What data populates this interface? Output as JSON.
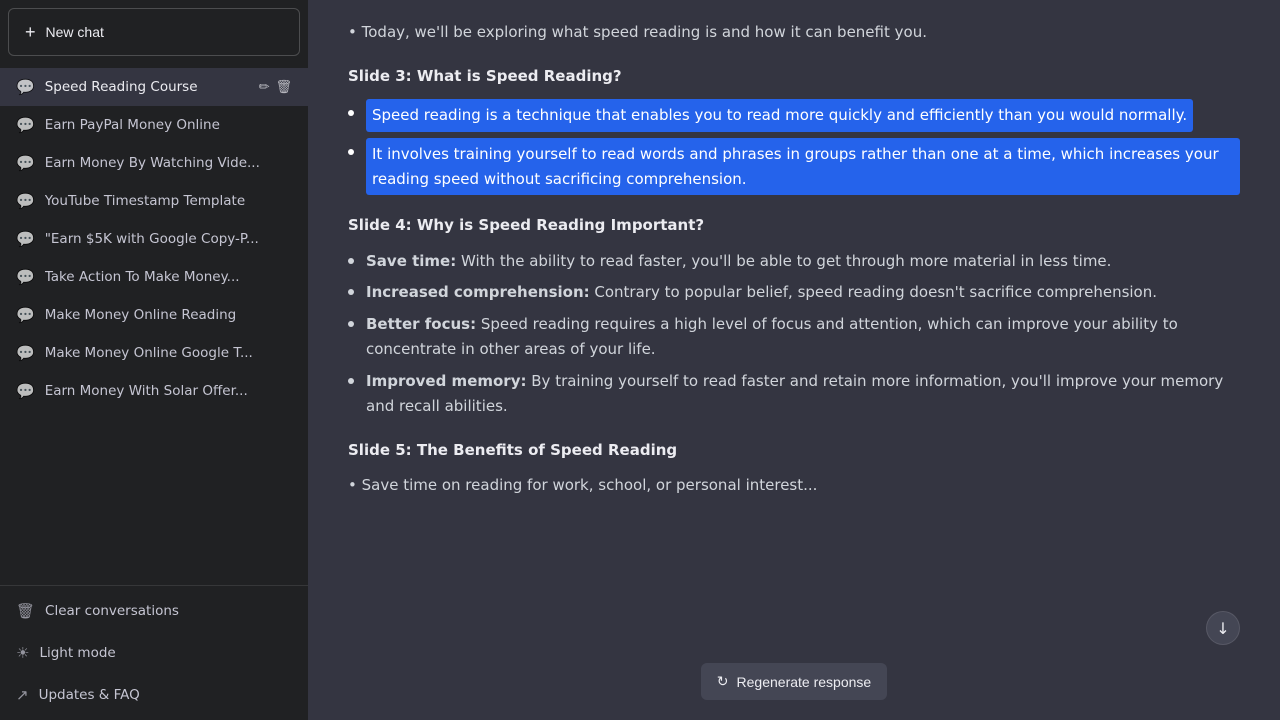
{
  "sidebar": {
    "new_chat_label": "New chat",
    "conversations": [
      {
        "id": "speed-reading",
        "label": "Speed Reading Course",
        "active": true,
        "show_actions": true
      },
      {
        "id": "earn-paypal",
        "label": "Earn PayPal Money Online",
        "active": false,
        "show_actions": false
      },
      {
        "id": "earn-watching",
        "label": "Earn Money By Watching Vide...",
        "active": false,
        "show_actions": false
      },
      {
        "id": "yt-timestamp",
        "label": "YouTube Timestamp Template",
        "active": false,
        "show_actions": false
      },
      {
        "id": "earn-5k-google",
        "label": "\"Earn $5K with Google Copy-P...",
        "active": false,
        "show_actions": false
      },
      {
        "id": "take-action",
        "label": "Take Action To Make Money...",
        "active": false,
        "show_actions": false
      },
      {
        "id": "make-money-reading",
        "label": "Make Money Online Reading",
        "active": false,
        "show_actions": false
      },
      {
        "id": "make-money-google",
        "label": "Make Money Online Google T...",
        "active": false,
        "show_actions": false
      },
      {
        "id": "earn-solar",
        "label": "Earn Money With Solar Offer...",
        "active": false,
        "show_actions": false
      }
    ],
    "bottom_items": [
      {
        "id": "clear-conversations",
        "label": "Clear conversations",
        "icon": "🗑"
      },
      {
        "id": "light-mode",
        "label": "Light mode",
        "icon": "☀"
      },
      {
        "id": "updates-faq",
        "label": "Updates & FAQ",
        "icon": "↗"
      }
    ]
  },
  "main": {
    "intro_line": "Today, we'll be exploring what speed reading is and how it can benefit you.",
    "slide3_heading": "Slide 3: What is Speed Reading?",
    "slide3_bullets": [
      "Speed reading is a technique that enables you to read more quickly and efficiently than you would normally.",
      "It involves training yourself to read words and phrases in groups rather than one at a time, which increases your reading speed without sacrificing comprehension."
    ],
    "slide4_heading": "Slide 4: Why is Speed Reading Important?",
    "slide4_bullets": [
      {
        "label": "Save time:",
        "text": "With the ability to read faster, you'll be able to get through more material in less time."
      },
      {
        "label": "Increased comprehension:",
        "text": "Contrary to popular belief, speed reading doesn't sacrifice comprehension."
      },
      {
        "label": "Better focus:",
        "text": "Speed reading requires a high level of focus and attention, which can improve your ability to concentrate in other areas of your life."
      },
      {
        "label": "Improved memory:",
        "text": "By training yourself to read faster and retain more information, you'll improve your memory and recall abilities."
      }
    ],
    "slide5_heading": "Slide 5: The Benefits of Speed Reading",
    "slide5_partial": "• Save time on reading for work, school, or personal interest...",
    "regenerate_label": "Regenerate response"
  }
}
